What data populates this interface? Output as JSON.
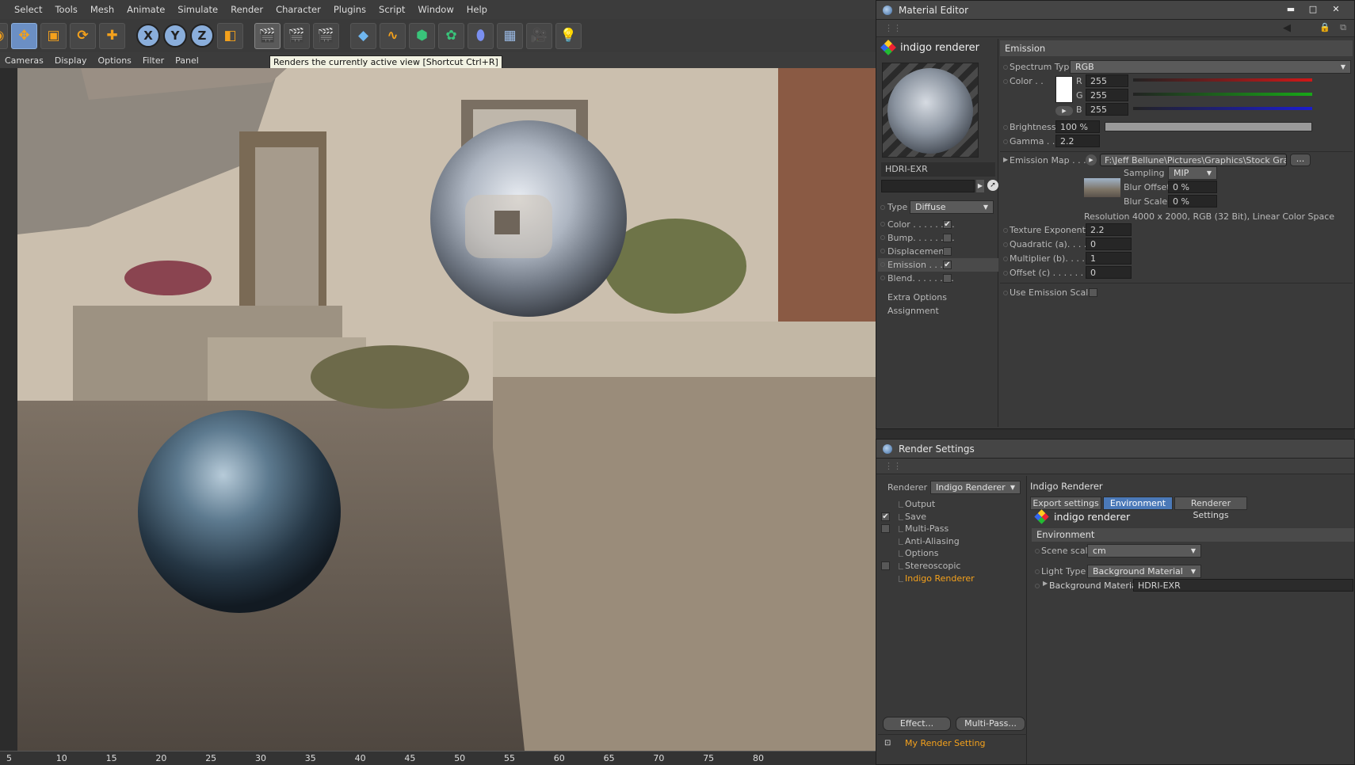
{
  "main_menu": [
    "Select",
    "Tools",
    "Mesh",
    "Animate",
    "Simulate",
    "Render",
    "Character",
    "Plugins",
    "Script",
    "Window",
    "Help"
  ],
  "toolbar_icons": [
    "live-selection-icon",
    "move-icon",
    "scale-icon",
    "rotate-icon",
    "add-object-icon",
    "x-axis-lock-icon",
    "y-axis-lock-icon",
    "z-axis-lock-icon",
    "coordinate-system-icon",
    "render-view-icon",
    "render-picture-viewer-icon",
    "edit-render-settings-icon",
    "cube-icon",
    "spline-pen-icon",
    "subdivision-surface-icon",
    "array-icon",
    "deformer-icon",
    "floor-icon",
    "camera-icon",
    "light-icon"
  ],
  "toolbar_axis": {
    "x": "X",
    "y": "Y",
    "z": "Z"
  },
  "viewport_menu": [
    "Cameras",
    "Display",
    "Options",
    "Filter",
    "Panel"
  ],
  "tooltip": "Renders the currently active view [Shortcut Ctrl+R]",
  "ruler": [
    "5",
    "10",
    "15",
    "20",
    "25",
    "30",
    "35",
    "40",
    "45",
    "50",
    "55",
    "60",
    "65",
    "70",
    "75",
    "80"
  ],
  "material_editor": {
    "title": "Material Editor",
    "window_buttons": {
      "minimize": "▬",
      "maximize": "□",
      "close": "✕"
    },
    "material_name": "indigo renderer",
    "preview_label": "HDRI-EXR",
    "type_label": "Type",
    "type_value": "Diffuse",
    "channels": [
      {
        "label": "Color . . . . . . . .",
        "checked": "✔"
      },
      {
        "label": "Bump. . . . . . . .",
        "checked": ""
      },
      {
        "label": "Displacement",
        "checked": ""
      },
      {
        "label": "Emission . . . .",
        "checked": "✔"
      },
      {
        "label": "Blend. . . . . . . .",
        "checked": ""
      }
    ],
    "extra_options": "Extra Options",
    "assignment": "Assignment",
    "section": "Emission",
    "spectrum_label": "Spectrum Type",
    "spectrum_value": "RGB",
    "color_label": "Color . .",
    "rgb": [
      {
        "ch": "R",
        "val": "255"
      },
      {
        "ch": "G",
        "val": "255"
      },
      {
        "ch": "B",
        "val": "255"
      }
    ],
    "brightness_label": "Brightness",
    "brightness_value": "100 %",
    "gamma_label": "Gamma . .",
    "gamma_value": "2.2",
    "emission_map_label": "Emission Map . . . .",
    "emission_map_path": "F:\\Jeff Bellune\\Pictures\\Graphics\\Stock Graphics",
    "browse_label": "...",
    "sampling_label": "Sampling",
    "sampling_value": "MIP",
    "blur_offset_label": "Blur Offset",
    "blur_offset_value": "0 %",
    "blur_scale_label": "Blur Scale",
    "blur_scale_value": "0 %",
    "resolution_text": "Resolution 4000 x 2000, RGB (32 Bit), Linear Color Space",
    "texture_exponent_label": "Texture Exponent",
    "texture_exponent_value": "2.2",
    "quadratic_label": "Quadratic (a). . . .",
    "quadratic_value": "0",
    "multiplier_label": "Multiplier (b). . . .",
    "multiplier_value": "1",
    "offset_label": "Offset (c) . . . . . .",
    "offset_value": "0",
    "use_emission_scale_label": "Use Emission Scale",
    "colors": {
      "r": "#d01818",
      "g": "#18a818",
      "b": "#1c1ccf",
      "accent": "#f4a11c"
    }
  },
  "render_settings": {
    "title": "Render Settings",
    "renderer_label": "Renderer",
    "renderer_value": "Indigo Renderer",
    "tree": [
      {
        "label": "Output",
        "check": "none"
      },
      {
        "label": "Save",
        "check": "✔"
      },
      {
        "label": "Multi-Pass",
        "check": ""
      },
      {
        "label": "Anti-Aliasing",
        "check": "none"
      },
      {
        "label": "Options",
        "check": "none"
      },
      {
        "label": "Stereoscopic",
        "check": ""
      },
      {
        "label": "Indigo Renderer",
        "check": "none"
      }
    ],
    "effect_button": "Effect...",
    "multipass_button": "Multi-Pass...",
    "my_render_setting": "My Render Setting",
    "right_title": "Indigo Renderer",
    "tabs": [
      "Export settings",
      "Environment",
      "Renderer Settings"
    ],
    "logo_text": "indigo renderer",
    "section": "Environment",
    "scene_scale_label": "Scene scale",
    "scene_scale_value": "cm",
    "light_type_label": "Light Type",
    "light_type_value": "Background Material",
    "background_material_label": "Background Material",
    "background_material_value": "HDRI-EXR"
  }
}
